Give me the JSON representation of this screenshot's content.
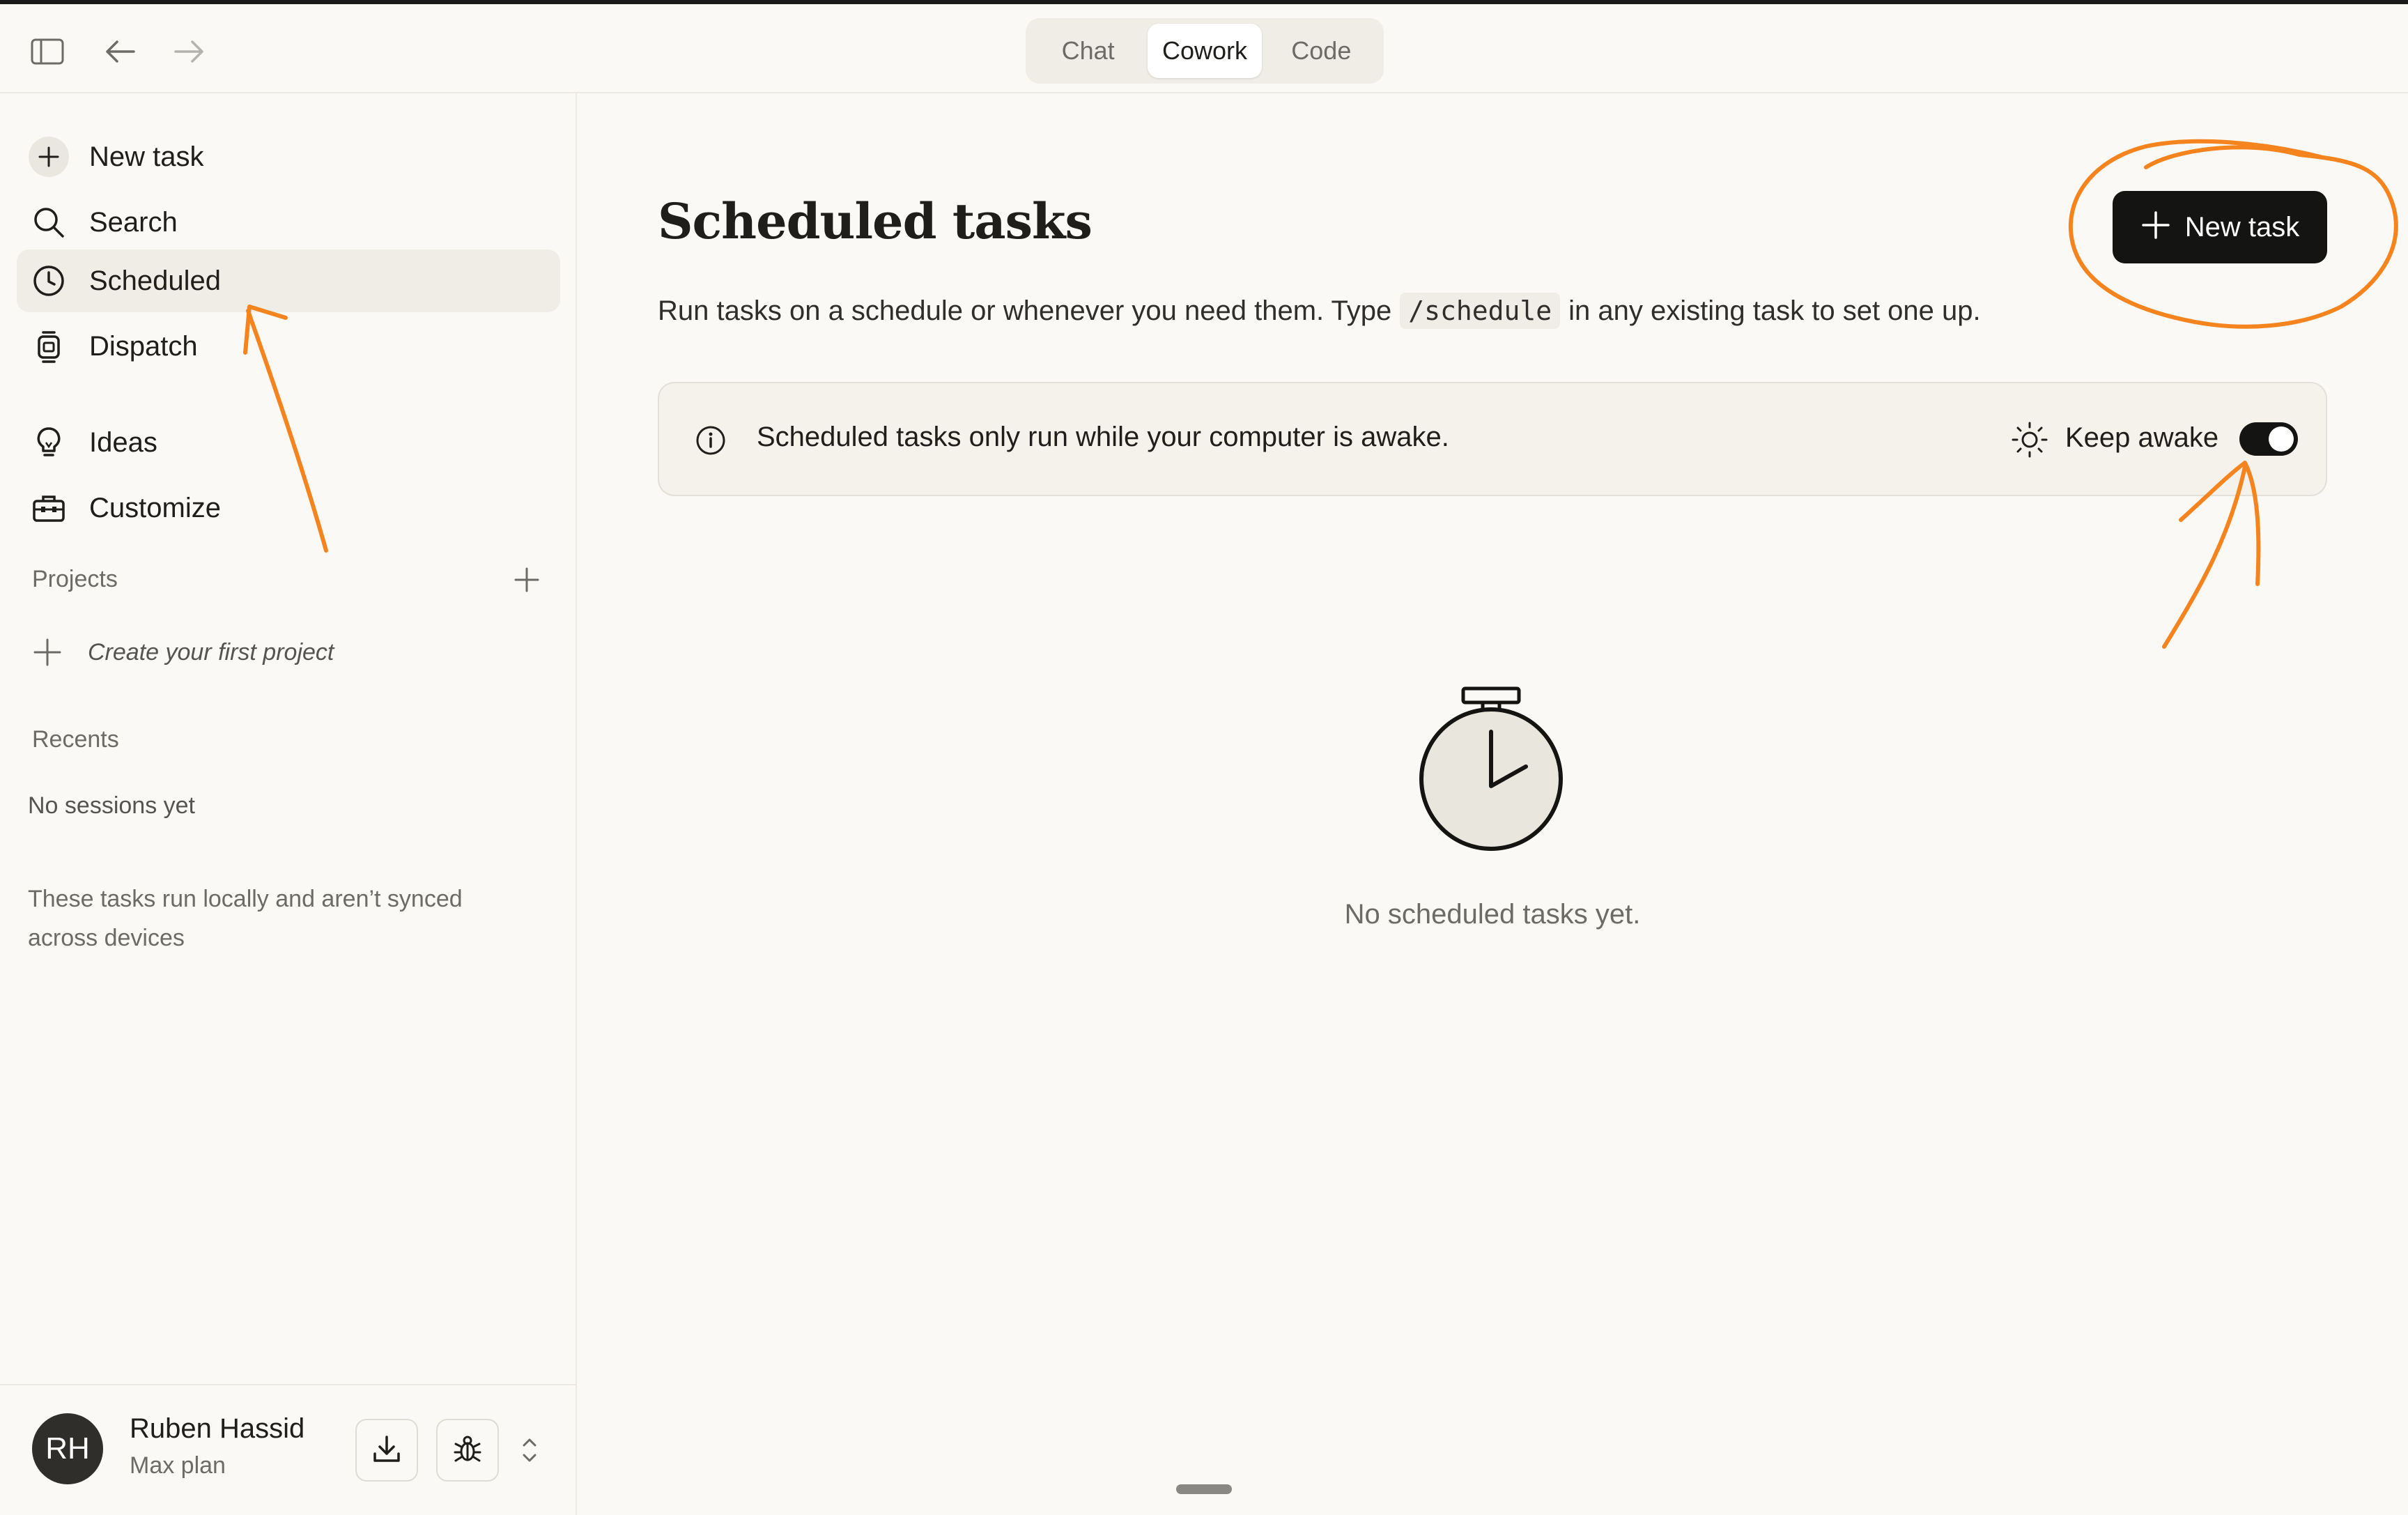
{
  "topbar": {
    "modes": [
      {
        "label": "Chat",
        "active": false
      },
      {
        "label": "Cowork",
        "active": true
      },
      {
        "label": "Code",
        "active": false
      }
    ]
  },
  "sidebar": {
    "items": [
      {
        "label": "New task",
        "icon": "plus-icon"
      },
      {
        "label": "Search",
        "icon": "search-icon"
      },
      {
        "label": "Scheduled",
        "icon": "clock-icon",
        "active": true
      },
      {
        "label": "Dispatch",
        "icon": "watch-icon"
      },
      {
        "label": "Ideas",
        "icon": "lightbulb-icon"
      },
      {
        "label": "Customize",
        "icon": "toolbox-icon"
      }
    ],
    "projects_label": "Projects",
    "create_project": "Create your first project",
    "recents_label": "Recents",
    "no_sessions": "No sessions yet",
    "sync_note": "These tasks run locally and aren’t synced across devices",
    "user": {
      "initials": "RH",
      "name": "Ruben Hassid",
      "plan": "Max plan"
    }
  },
  "main": {
    "title": "Scheduled tasks",
    "subtitle_before": "Run tasks on a schedule or whenever you need them. Type",
    "subtitle_code": "/schedule",
    "subtitle_after": "in any existing task to set one up.",
    "new_task_label": "New task",
    "notice": {
      "text": "Scheduled tasks only run while your computer is awake.",
      "keep_awake_label": "Keep awake",
      "keep_awake_on": true
    },
    "empty_state": "No scheduled tasks yet."
  },
  "colors": {
    "background": "#faf9f5",
    "primary_button": "#141413",
    "annotation": "#f5841f"
  }
}
